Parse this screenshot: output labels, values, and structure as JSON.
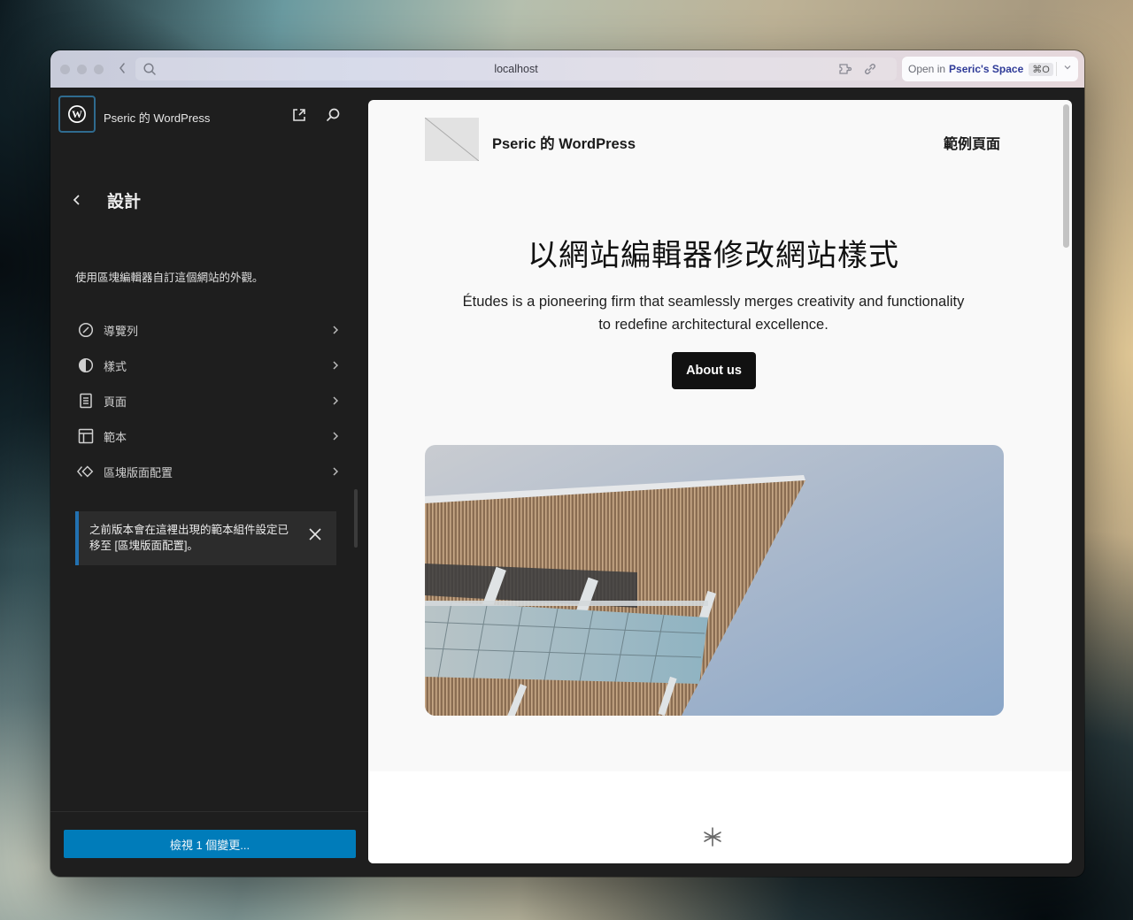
{
  "browser": {
    "url": "localhost",
    "open_in": {
      "prefix": "Open in",
      "space": "Pseric's Space",
      "shortcut": "⌘O"
    },
    "icons": [
      "back-icon",
      "search-icon",
      "extension-icon",
      "link-icon",
      "chevron-down-icon"
    ]
  },
  "sidebar": {
    "site_title": "Pseric 的 WordPress",
    "panel_title": "設計",
    "panel_description": "使用區塊編輯器自訂這個網站的外觀。",
    "menu": [
      {
        "label": "導覽列",
        "icon": "navigation-icon"
      },
      {
        "label": "樣式",
        "icon": "styles-icon"
      },
      {
        "label": "頁面",
        "icon": "page-icon"
      },
      {
        "label": "範本",
        "icon": "template-icon"
      },
      {
        "label": "區塊版面配置",
        "icon": "patterns-icon"
      }
    ],
    "notice": "之前版本會在這裡出現的範本組件設定已移至 [區塊版面配置]。",
    "review_button": "檢視 1 個變更..."
  },
  "canvas": {
    "site_name": "Pseric 的 WordPress",
    "nav_link": "範例頁面",
    "hero_title": "以網站編輯器修改網站樣式",
    "hero_text": "Études is a pioneering firm that seamlessly merges creativity and functionality to redefine architectural excellence.",
    "about_button": "About us"
  },
  "colors": {
    "accent": "#007cba",
    "notice_border": "#2271b1",
    "site_icon_focus": "#2f6b8f",
    "sidebar_bg": "#1e1e1e",
    "open_in_brand": "#2f3b98"
  }
}
